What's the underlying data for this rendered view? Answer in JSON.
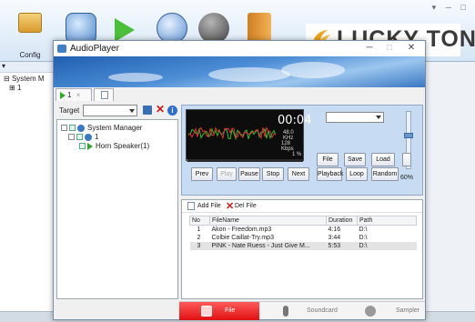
{
  "main_app": {
    "config_label": "Config",
    "logo_text": "LUCKY TONE",
    "window_controls": "▾ ─ □",
    "left_panel_header": "▾",
    "tree_root": "System M",
    "tree_child": "1"
  },
  "dialog": {
    "title": "AudioPlayer",
    "controls": {
      "minimize": "─",
      "maximize": "□",
      "close": "✕"
    },
    "tab_label": "1",
    "tab_close": "×"
  },
  "target": {
    "label": "Target",
    "value": ""
  },
  "tree": {
    "root": "System Manager",
    "group": "1",
    "device": "Horn Speaker(1)"
  },
  "player": {
    "time": "00:04",
    "sample_rate": "48.0 KHz",
    "bitrate": "128 Kbps",
    "percent_label": "1 %",
    "progress": 0.01,
    "mode_select": "",
    "volume_label": "60%",
    "volume": 0.6,
    "buttons": {
      "file": "File",
      "save": "Save",
      "load": "Load",
      "prev": "Prev",
      "play": "Play",
      "pause": "Pause",
      "stop": "Stop",
      "next": "Next",
      "playback": "Playback",
      "loop": "Loop",
      "random": "Random"
    }
  },
  "file_list": {
    "add_label": "Add File",
    "del_label": "Del File",
    "columns": [
      "No",
      "FileName",
      "Duration",
      "Path"
    ],
    "rows": [
      [
        "1",
        "Akon - Freedom.mp3",
        "4:16",
        "D:\\"
      ],
      [
        "2",
        "Colbie Caillat-Try.mp3",
        "3:44",
        "D:\\"
      ],
      [
        "3",
        "PINK - Nate Ruess - Just Give M...",
        "5:53",
        "D:\\"
      ]
    ],
    "selected_row": 2
  },
  "bottom_tabs": {
    "file": "File",
    "soundcard": "Soundcard",
    "sampler": "Sampler"
  },
  "colors": {
    "accent_red": "#e01010",
    "lcd_bg": "#0d0d0d",
    "banner_blue": "#2f6fc0",
    "wave_red": "#e03030",
    "wave_green": "#30c030"
  }
}
